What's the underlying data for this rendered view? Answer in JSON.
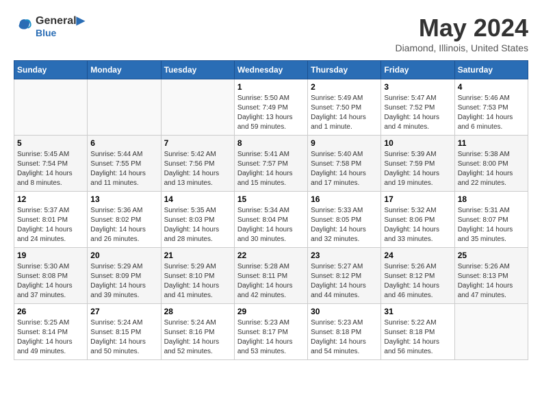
{
  "header": {
    "logo_line1": "General",
    "logo_line2": "Blue",
    "month_year": "May 2024",
    "location": "Diamond, Illinois, United States"
  },
  "weekdays": [
    "Sunday",
    "Monday",
    "Tuesday",
    "Wednesday",
    "Thursday",
    "Friday",
    "Saturday"
  ],
  "weeks": [
    [
      {
        "day": "",
        "sunrise": "",
        "sunset": "",
        "daylight": ""
      },
      {
        "day": "",
        "sunrise": "",
        "sunset": "",
        "daylight": ""
      },
      {
        "day": "",
        "sunrise": "",
        "sunset": "",
        "daylight": ""
      },
      {
        "day": "1",
        "sunrise": "Sunrise: 5:50 AM",
        "sunset": "Sunset: 7:49 PM",
        "daylight": "Daylight: 13 hours and 59 minutes."
      },
      {
        "day": "2",
        "sunrise": "Sunrise: 5:49 AM",
        "sunset": "Sunset: 7:50 PM",
        "daylight": "Daylight: 14 hours and 1 minute."
      },
      {
        "day": "3",
        "sunrise": "Sunrise: 5:47 AM",
        "sunset": "Sunset: 7:52 PM",
        "daylight": "Daylight: 14 hours and 4 minutes."
      },
      {
        "day": "4",
        "sunrise": "Sunrise: 5:46 AM",
        "sunset": "Sunset: 7:53 PM",
        "daylight": "Daylight: 14 hours and 6 minutes."
      }
    ],
    [
      {
        "day": "5",
        "sunrise": "Sunrise: 5:45 AM",
        "sunset": "Sunset: 7:54 PM",
        "daylight": "Daylight: 14 hours and 8 minutes."
      },
      {
        "day": "6",
        "sunrise": "Sunrise: 5:44 AM",
        "sunset": "Sunset: 7:55 PM",
        "daylight": "Daylight: 14 hours and 11 minutes."
      },
      {
        "day": "7",
        "sunrise": "Sunrise: 5:42 AM",
        "sunset": "Sunset: 7:56 PM",
        "daylight": "Daylight: 14 hours and 13 minutes."
      },
      {
        "day": "8",
        "sunrise": "Sunrise: 5:41 AM",
        "sunset": "Sunset: 7:57 PM",
        "daylight": "Daylight: 14 hours and 15 minutes."
      },
      {
        "day": "9",
        "sunrise": "Sunrise: 5:40 AM",
        "sunset": "Sunset: 7:58 PM",
        "daylight": "Daylight: 14 hours and 17 minutes."
      },
      {
        "day": "10",
        "sunrise": "Sunrise: 5:39 AM",
        "sunset": "Sunset: 7:59 PM",
        "daylight": "Daylight: 14 hours and 19 minutes."
      },
      {
        "day": "11",
        "sunrise": "Sunrise: 5:38 AM",
        "sunset": "Sunset: 8:00 PM",
        "daylight": "Daylight: 14 hours and 22 minutes."
      }
    ],
    [
      {
        "day": "12",
        "sunrise": "Sunrise: 5:37 AM",
        "sunset": "Sunset: 8:01 PM",
        "daylight": "Daylight: 14 hours and 24 minutes."
      },
      {
        "day": "13",
        "sunrise": "Sunrise: 5:36 AM",
        "sunset": "Sunset: 8:02 PM",
        "daylight": "Daylight: 14 hours and 26 minutes."
      },
      {
        "day": "14",
        "sunrise": "Sunrise: 5:35 AM",
        "sunset": "Sunset: 8:03 PM",
        "daylight": "Daylight: 14 hours and 28 minutes."
      },
      {
        "day": "15",
        "sunrise": "Sunrise: 5:34 AM",
        "sunset": "Sunset: 8:04 PM",
        "daylight": "Daylight: 14 hours and 30 minutes."
      },
      {
        "day": "16",
        "sunrise": "Sunrise: 5:33 AM",
        "sunset": "Sunset: 8:05 PM",
        "daylight": "Daylight: 14 hours and 32 minutes."
      },
      {
        "day": "17",
        "sunrise": "Sunrise: 5:32 AM",
        "sunset": "Sunset: 8:06 PM",
        "daylight": "Daylight: 14 hours and 33 minutes."
      },
      {
        "day": "18",
        "sunrise": "Sunrise: 5:31 AM",
        "sunset": "Sunset: 8:07 PM",
        "daylight": "Daylight: 14 hours and 35 minutes."
      }
    ],
    [
      {
        "day": "19",
        "sunrise": "Sunrise: 5:30 AM",
        "sunset": "Sunset: 8:08 PM",
        "daylight": "Daylight: 14 hours and 37 minutes."
      },
      {
        "day": "20",
        "sunrise": "Sunrise: 5:29 AM",
        "sunset": "Sunset: 8:09 PM",
        "daylight": "Daylight: 14 hours and 39 minutes."
      },
      {
        "day": "21",
        "sunrise": "Sunrise: 5:29 AM",
        "sunset": "Sunset: 8:10 PM",
        "daylight": "Daylight: 14 hours and 41 minutes."
      },
      {
        "day": "22",
        "sunrise": "Sunrise: 5:28 AM",
        "sunset": "Sunset: 8:11 PM",
        "daylight": "Daylight: 14 hours and 42 minutes."
      },
      {
        "day": "23",
        "sunrise": "Sunrise: 5:27 AM",
        "sunset": "Sunset: 8:12 PM",
        "daylight": "Daylight: 14 hours and 44 minutes."
      },
      {
        "day": "24",
        "sunrise": "Sunrise: 5:26 AM",
        "sunset": "Sunset: 8:12 PM",
        "daylight": "Daylight: 14 hours and 46 minutes."
      },
      {
        "day": "25",
        "sunrise": "Sunrise: 5:26 AM",
        "sunset": "Sunset: 8:13 PM",
        "daylight": "Daylight: 14 hours and 47 minutes."
      }
    ],
    [
      {
        "day": "26",
        "sunrise": "Sunrise: 5:25 AM",
        "sunset": "Sunset: 8:14 PM",
        "daylight": "Daylight: 14 hours and 49 minutes."
      },
      {
        "day": "27",
        "sunrise": "Sunrise: 5:24 AM",
        "sunset": "Sunset: 8:15 PM",
        "daylight": "Daylight: 14 hours and 50 minutes."
      },
      {
        "day": "28",
        "sunrise": "Sunrise: 5:24 AM",
        "sunset": "Sunset: 8:16 PM",
        "daylight": "Daylight: 14 hours and 52 minutes."
      },
      {
        "day": "29",
        "sunrise": "Sunrise: 5:23 AM",
        "sunset": "Sunset: 8:17 PM",
        "daylight": "Daylight: 14 hours and 53 minutes."
      },
      {
        "day": "30",
        "sunrise": "Sunrise: 5:23 AM",
        "sunset": "Sunset: 8:18 PM",
        "daylight": "Daylight: 14 hours and 54 minutes."
      },
      {
        "day": "31",
        "sunrise": "Sunrise: 5:22 AM",
        "sunset": "Sunset: 8:18 PM",
        "daylight": "Daylight: 14 hours and 56 minutes."
      },
      {
        "day": "",
        "sunrise": "",
        "sunset": "",
        "daylight": ""
      }
    ]
  ]
}
